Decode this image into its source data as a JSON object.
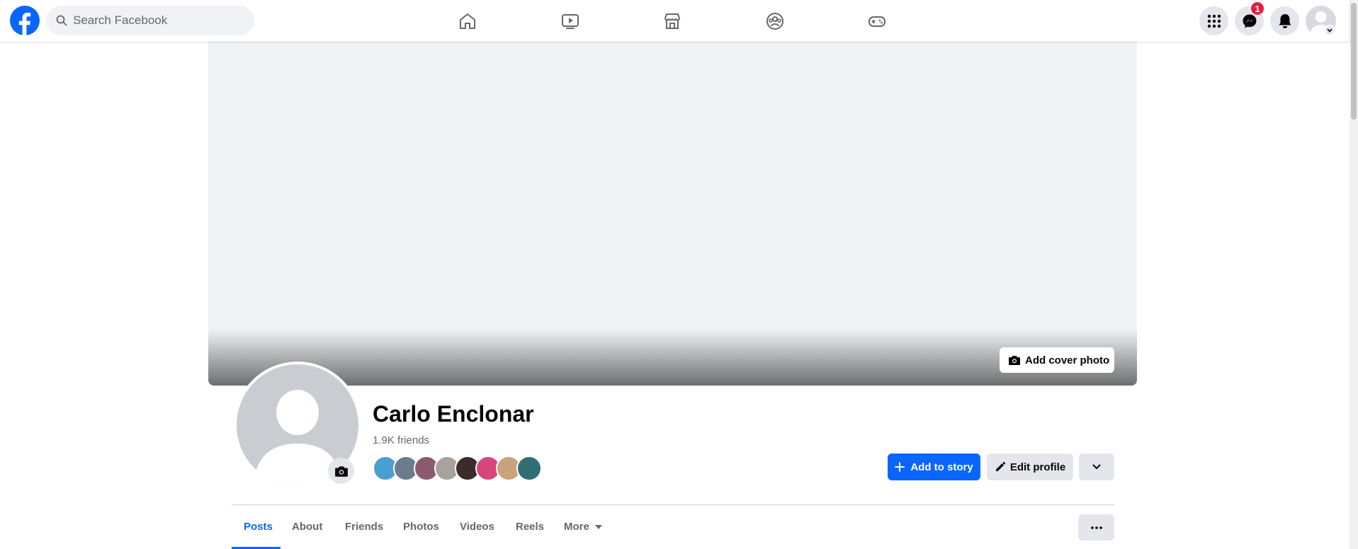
{
  "topbar": {
    "search_placeholder": "Search Facebook",
    "nav": [
      "home-icon",
      "video-icon",
      "marketplace-icon",
      "groups-icon",
      "gaming-icon"
    ],
    "messenger_badge": "1"
  },
  "cover": {
    "add_cover_label": "Add cover photo"
  },
  "profile": {
    "name": "Carlo Enclonar",
    "friends_count": "1.9K friends",
    "friend_avatar_colors": [
      "#4a9fd1",
      "#6b7d8c",
      "#8a5a6e",
      "#a8a29a",
      "#3a2c2a",
      "#d6457c",
      "#c9a37a",
      "#2f6f73"
    ]
  },
  "actions": {
    "add_story": "Add to story",
    "edit_profile": "Edit profile"
  },
  "tabs": [
    "Posts",
    "About",
    "Friends",
    "Photos",
    "Videos",
    "Reels",
    "More"
  ],
  "colors": {
    "brand": "#0866ff",
    "badge": "#e41e3f"
  }
}
